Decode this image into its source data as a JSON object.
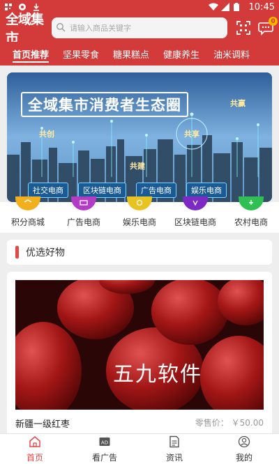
{
  "statusbar": {
    "time": "10:45"
  },
  "header": {
    "logo": "全域集市",
    "search_placeholder": "请输入商品关键字",
    "message_badge": "0"
  },
  "tabs": [
    {
      "label": "首页推荐"
    },
    {
      "label": "坚果零食"
    },
    {
      "label": "糖果糕点"
    },
    {
      "label": "健康养生"
    },
    {
      "label": "油米调料"
    }
  ],
  "banner": {
    "title": "全域集市消费者生态圈",
    "float_tags": [
      "共赢",
      "共创",
      "共享",
      "共建"
    ],
    "pills": [
      "社交电商",
      "区块链电商",
      "广告电商",
      "娱乐电商"
    ]
  },
  "categories": [
    {
      "label": "积分商城",
      "icon": "points-mall-icon",
      "color": "#f2b01e"
    },
    {
      "label": "广告电商",
      "icon": "ad-commerce-icon",
      "color": "#b23cc4"
    },
    {
      "label": "娱乐电商",
      "icon": "entertainment-icon",
      "color": "#e7c421"
    },
    {
      "label": "区块链电商",
      "icon": "blockchain-icon",
      "color": "#7b2bc4"
    },
    {
      "label": "农村电商",
      "icon": "rural-icon",
      "color": "#2fbf53"
    }
  ],
  "section": {
    "title": "优选好物"
  },
  "product": {
    "name": "新疆一级红枣",
    "price_label": "零售价：",
    "price_value": "￥50.00",
    "watermark": "五九软件"
  },
  "bottom_nav": [
    {
      "label": "首页",
      "icon": "home-icon",
      "active": true
    },
    {
      "label": "看广告",
      "icon": "ad-icon",
      "active": false
    },
    {
      "label": "资讯",
      "icon": "news-icon",
      "active": false
    },
    {
      "label": "我的",
      "icon": "user-icon",
      "active": false
    }
  ],
  "colors": {
    "brand": "#d33b3b",
    "accent": "#e84545"
  }
}
